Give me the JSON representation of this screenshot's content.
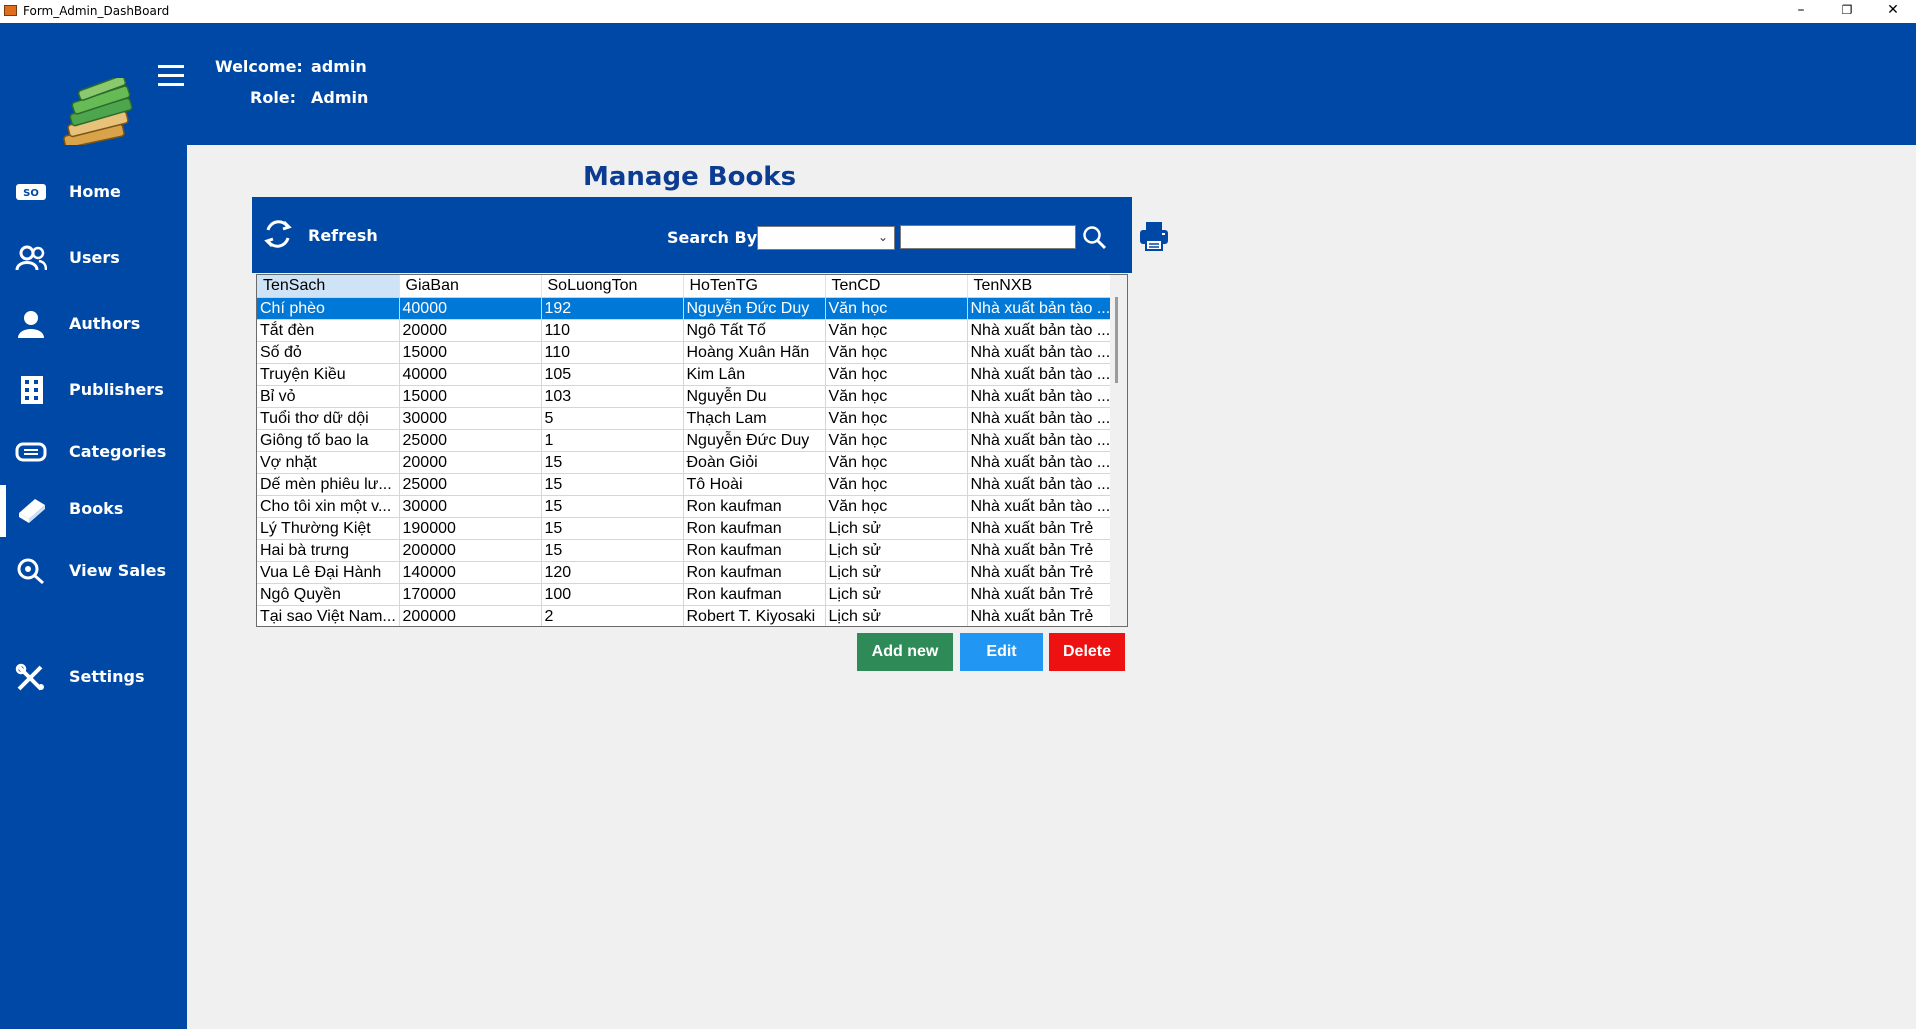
{
  "window": {
    "title": "Form_Admin_DashBoard",
    "minimize": "–",
    "maximize": "❐",
    "close": "✕"
  },
  "header": {
    "welcome_label": "Welcome:",
    "welcome_value": "admin",
    "role_label": "Role:",
    "role_value": "Admin"
  },
  "sidebar": {
    "items": [
      {
        "label": "Home",
        "icon": "home-icon"
      },
      {
        "label": "Users",
        "icon": "users-icon"
      },
      {
        "label": "Authors",
        "icon": "author-icon"
      },
      {
        "label": "Publishers",
        "icon": "publisher-icon"
      },
      {
        "label": "Categories",
        "icon": "category-icon"
      },
      {
        "label": "Books",
        "icon": "books-icon",
        "active": true
      },
      {
        "label": "View Sales",
        "icon": "view-sales-icon"
      },
      {
        "label": "Settings",
        "icon": "settings-icon"
      }
    ]
  },
  "main": {
    "title": "Manage Books",
    "refresh_label": "Refresh",
    "search_by_label": "Search By:",
    "search_by_value": "",
    "search_value": ""
  },
  "grid": {
    "columns": [
      "TenSach",
      "GiaBan",
      "SoLuongTon",
      "HoTenTG",
      "TenCD",
      "TenNXB"
    ],
    "rows": [
      [
        "Chí phèo",
        "40000",
        "192",
        "Nguyễn Đức Duy",
        "Văn học",
        "Nhà xuất bản tào ..."
      ],
      [
        "Tắt đèn",
        "20000",
        "110",
        "Ngô Tất Tố",
        "Văn học",
        "Nhà xuất bản tào ..."
      ],
      [
        "Số đỏ",
        "15000",
        "110",
        "Hoàng Xuân Hãn",
        "Văn học",
        "Nhà xuất bản tào ..."
      ],
      [
        "Truyện Kiều",
        "40000",
        "105",
        "Kim Lân",
        "Văn học",
        "Nhà xuất bản tào ..."
      ],
      [
        "Bỉ vỏ",
        "15000",
        "103",
        "Nguyễn Du",
        "Văn học",
        "Nhà xuất bản tào ..."
      ],
      [
        "Tuổi thơ dữ dội",
        "30000",
        "5",
        "Thạch Lam",
        "Văn học",
        "Nhà xuất bản tào ..."
      ],
      [
        "Giông tố bao la",
        "25000",
        "1",
        "Nguyễn Đức Duy",
        "Văn học",
        "Nhà xuất bản tào ..."
      ],
      [
        "Vợ nhặt",
        "20000",
        "15",
        "Đoàn Giỏi",
        "Văn học",
        "Nhà xuất bản tào ..."
      ],
      [
        "Dế mèn phiêu lư...",
        "25000",
        "15",
        "Tô Hoài",
        "Văn học",
        "Nhà xuất bản tào ..."
      ],
      [
        "Cho tôi xin một v...",
        "30000",
        "15",
        "Ron kaufman",
        "Văn học",
        "Nhà xuất bản tào ..."
      ],
      [
        "Lý Thường Kiệt",
        "190000",
        "15",
        "Ron kaufman",
        "Lịch sử",
        "Nhà xuất bản Trẻ"
      ],
      [
        "Hai bà trưng",
        "200000",
        "15",
        "Ron kaufman",
        "Lịch sử",
        "Nhà xuất bản Trẻ"
      ],
      [
        "Vua Lê Đại Hành",
        "140000",
        "120",
        "Ron kaufman",
        "Lịch sử",
        "Nhà xuất bản Trẻ"
      ],
      [
        "Ngô Quyền",
        "170000",
        "100",
        "Ron kaufman",
        "Lịch sử",
        "Nhà xuất bản Trẻ"
      ],
      [
        "Tại sao Việt Nam...",
        "200000",
        "2",
        "Robert T. Kiyosaki",
        "Lịch sử",
        "Nhà xuất bản Trẻ"
      ]
    ]
  },
  "actions": {
    "add_label": "Add new",
    "edit_label": "Edit",
    "delete_label": "Delete"
  },
  "colors": {
    "brand": "#0048a5",
    "selected": "#0078d7",
    "add": "#2e8b57",
    "edit": "#2196f3",
    "delete": "#ee1111"
  }
}
